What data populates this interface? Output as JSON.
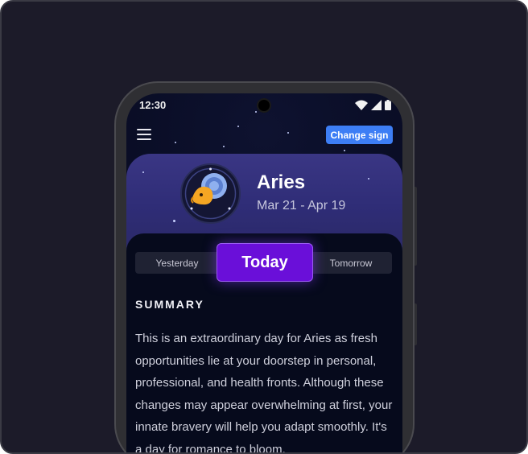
{
  "status_bar": {
    "time": "12:30",
    "icons": [
      "wifi-icon",
      "cell-signal-icon",
      "battery-icon"
    ]
  },
  "header": {
    "menu_icon": "hamburger-menu-icon",
    "change_sign_label": "Change sign"
  },
  "sign": {
    "name": "Aries",
    "dates": "Mar 21 - Apr 19",
    "emblem_icon": "ram-icon"
  },
  "tabs": {
    "yesterday": "Yesterday",
    "today": "Today",
    "tomorrow": "Tomorrow",
    "selected": "Today"
  },
  "summary": {
    "heading": "SUMMARY",
    "text": "This is an extraordinary day for Aries as fresh opportunities lie at your doorstep in personal, professional, and health fronts. Although these changes may appear overwhelming at first, your innate bravery will help you adapt smoothly. It's a day for romance to bloom,"
  },
  "colors": {
    "background": "#1c1b29",
    "accent_button": "#3d7ef5",
    "selected_tab": "#6a0fd9",
    "hero": "#3a3684"
  }
}
